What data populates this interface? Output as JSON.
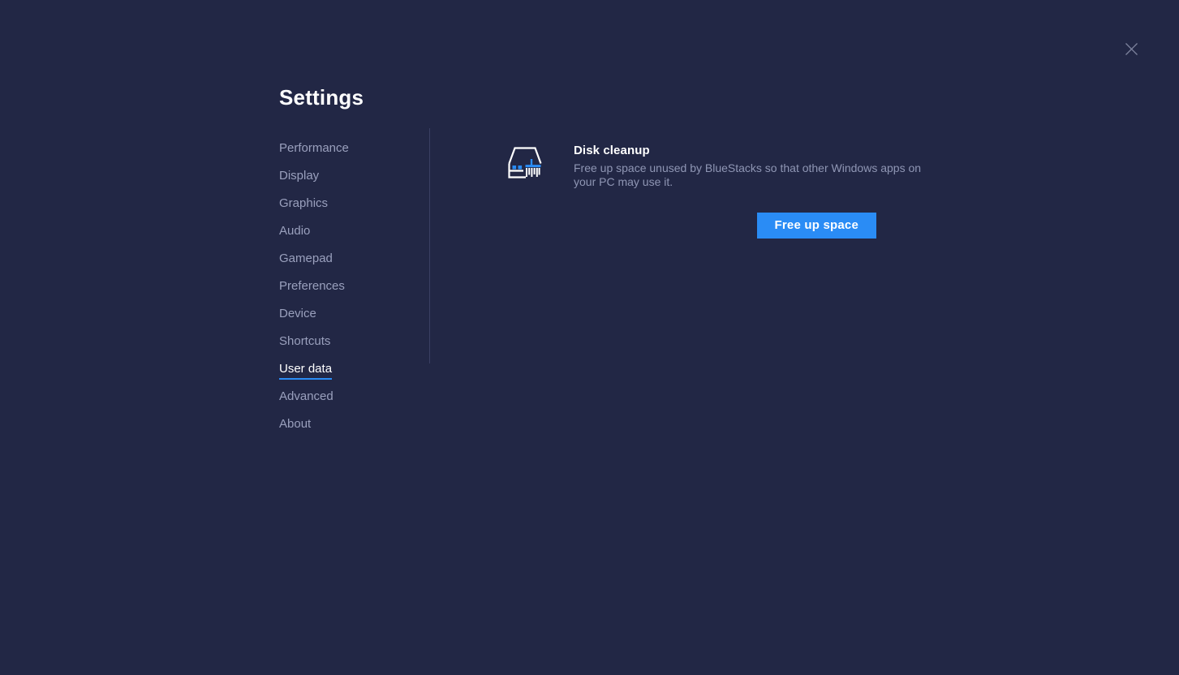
{
  "window": {
    "close_icon": "close-icon"
  },
  "settings": {
    "title": "Settings",
    "sidebar": {
      "items": [
        {
          "label": "Performance",
          "active": false
        },
        {
          "label": "Display",
          "active": false
        },
        {
          "label": "Graphics",
          "active": false
        },
        {
          "label": "Audio",
          "active": false
        },
        {
          "label": "Gamepad",
          "active": false
        },
        {
          "label": "Preferences",
          "active": false
        },
        {
          "label": "Device",
          "active": false
        },
        {
          "label": "Shortcuts",
          "active": false
        },
        {
          "label": "User data",
          "active": true
        },
        {
          "label": "Advanced",
          "active": false
        },
        {
          "label": "About",
          "active": false
        }
      ]
    },
    "content": {
      "icon": "disk-cleanup-icon",
      "title": "Disk cleanup",
      "description": "Free up space unused by BlueStacks so that other Windows apps on your PC may use it.",
      "action_button": "Free up space"
    }
  },
  "colors": {
    "background": "#222745",
    "accent": "#2a8cf5",
    "text_primary": "#ffffff",
    "text_muted": "#8f96b4",
    "sidebar_item": "#9aa0bd",
    "divider": "#3a3f63"
  }
}
